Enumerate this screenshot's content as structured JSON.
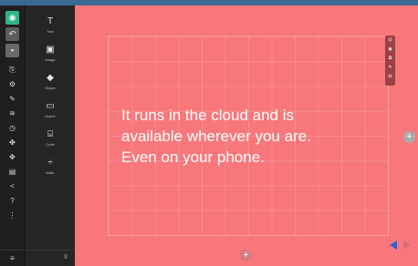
{
  "tools": [
    {
      "icon": "T",
      "label": "Text",
      "name": "text"
    },
    {
      "icon": "▣",
      "label": "Image",
      "name": "image"
    },
    {
      "icon": "◆",
      "label": "Shape",
      "name": "shape"
    },
    {
      "icon": "▭",
      "label": "Iframe",
      "name": "iframe"
    },
    {
      "icon": "⌸",
      "label": "Code",
      "name": "code"
    },
    {
      "icon": "÷",
      "label": "Math",
      "name": "math"
    }
  ],
  "rail": {
    "preview_icon": "eye-icon",
    "undo_icon": "undo-icon",
    "save_icon": "save-icon",
    "footer_icon": "menu-icon",
    "items": [
      {
        "glyph": "⎘",
        "name": "slides-icon"
      },
      {
        "glyph": "⚙",
        "name": "settings-icon"
      },
      {
        "glyph": "✎",
        "name": "edit-icon"
      },
      {
        "glyph": "≋",
        "name": "layers-icon"
      },
      {
        "glyph": "◷",
        "name": "history-icon"
      },
      {
        "glyph": "✤",
        "name": "theme-icon"
      },
      {
        "glyph": "✥",
        "name": "transition-icon"
      },
      {
        "glyph": "▤",
        "name": "export-icon"
      },
      {
        "glyph": "<",
        "name": "share-icon"
      },
      {
        "glyph": "?",
        "name": "help-icon"
      },
      {
        "glyph": "⋮",
        "name": "more-icon"
      }
    ]
  },
  "panel_footer": "II",
  "canvas": {
    "background": "#f7777a",
    "headline_lines": [
      "It runs in the cloud and is",
      "available wherever you are.",
      "Even on your phone."
    ]
  },
  "slide_toolbar": [
    "⊡",
    "◉",
    "⧉",
    "✎",
    "⊟"
  ],
  "add_symbol": "+"
}
